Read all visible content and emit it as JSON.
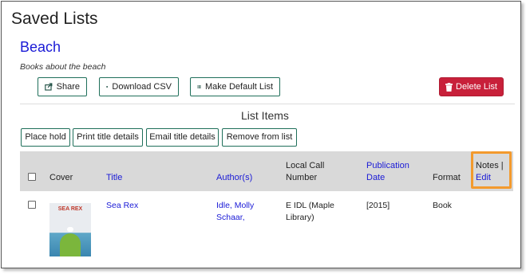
{
  "page": {
    "title": "Saved Lists"
  },
  "list": {
    "name": "Beach",
    "description": "Books about the beach"
  },
  "toolbar": {
    "share_label": "Share",
    "download_label": "Download CSV",
    "default_label": "Make Default List",
    "delete_label": "Delete List"
  },
  "section_title": "List Items",
  "actions": {
    "place_hold": "Place hold",
    "print_details": "Print title details",
    "email_details": "Email title details",
    "remove": "Remove from list"
  },
  "table": {
    "headers": {
      "cover": "Cover",
      "title": "Title",
      "author": "Author(s)",
      "call_number_1": "Local Call",
      "call_number_2": "Number",
      "pubdate_1": "Publication",
      "pubdate_2": "Date",
      "format": "Format",
      "notes": "Notes |",
      "edit": "Edit"
    },
    "rows": [
      {
        "cover_text": "SEA REX",
        "title": "Sea Rex",
        "author_1": "Idle, Molly",
        "author_2": "Schaar,",
        "call_1": "E IDL (Maple",
        "call_2": "Library)",
        "date": "[2015]",
        "format": "Book"
      }
    ]
  },
  "colors": {
    "accent": "#1a1ad6",
    "danger": "#c8203a",
    "outline": "#1f6f5a",
    "highlight": "#f39a2d"
  }
}
